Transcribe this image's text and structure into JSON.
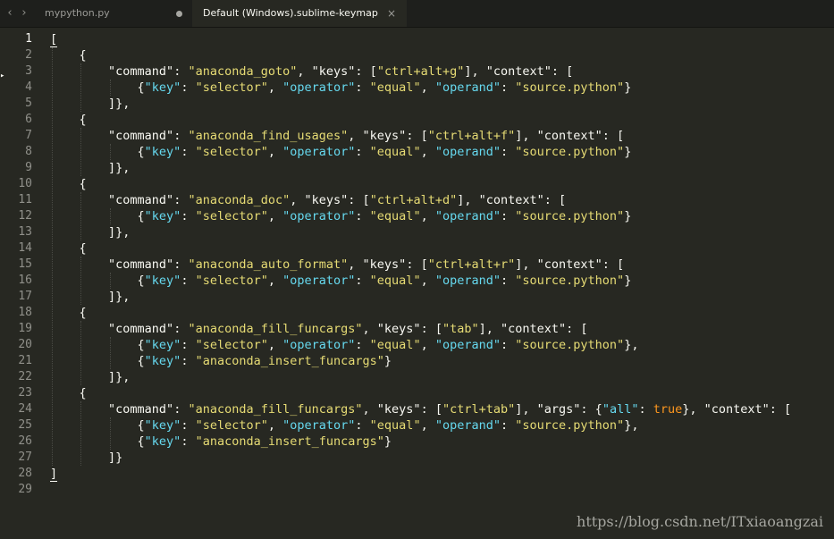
{
  "tabs": [
    {
      "label": "mypython.py",
      "active": false,
      "dirty": true
    },
    {
      "label": "Default (Windows).sublime-keymap",
      "active": true,
      "close_icon": "×"
    }
  ],
  "nav": {
    "back": "‹",
    "forward": "›"
  },
  "gutter": {
    "line_numbers": [
      "1",
      "2",
      "3",
      "4",
      "5",
      "6",
      "7",
      "8",
      "9",
      "10",
      "11",
      "12",
      "13",
      "14",
      "15",
      "16",
      "17",
      "18",
      "19",
      "20",
      "21",
      "22",
      "23",
      "24",
      "25",
      "26",
      "27",
      "28",
      "29"
    ],
    "active_line": "1"
  },
  "code_lines": [
    "[",
    "    {",
    "        \"command\": \"anaconda_goto\", \"keys\": [\"ctrl+alt+g\"], \"context\": [",
    "            {\"key\": \"selector\", \"operator\": \"equal\", \"operand\": \"source.python\"}",
    "        ]},",
    "    {",
    "        \"command\": \"anaconda_find_usages\", \"keys\": [\"ctrl+alt+f\"], \"context\": [",
    "            {\"key\": \"selector\", \"operator\": \"equal\", \"operand\": \"source.python\"}",
    "        ]},",
    "    {",
    "        \"command\": \"anaconda_doc\", \"keys\": [\"ctrl+alt+d\"], \"context\": [",
    "            {\"key\": \"selector\", \"operator\": \"equal\", \"operand\": \"source.python\"}",
    "        ]},",
    "    {",
    "        \"command\": \"anaconda_auto_format\", \"keys\": [\"ctrl+alt+r\"], \"context\": [",
    "            {\"key\": \"selector\", \"operator\": \"equal\", \"operand\": \"source.python\"}",
    "        ]},",
    "    {",
    "        \"command\": \"anaconda_fill_funcargs\", \"keys\": [\"tab\"], \"context\": [",
    "            {\"key\": \"selector\", \"operator\": \"equal\", \"operand\": \"source.python\"},",
    "            {\"key\": \"anaconda_insert_funcargs\"}",
    "        ]},",
    "    {",
    "        \"command\": \"anaconda_fill_funcargs\", \"keys\": [\"ctrl+tab\"], \"args\": {\"all\": true}, \"context\": [",
    "            {\"key\": \"selector\", \"operator\": \"equal\", \"operand\": \"source.python\"},",
    "            {\"key\": \"anaconda_insert_funcargs\"}",
    "        ]}",
    "]",
    ""
  ],
  "watermark": "https://blog.csdn.net/ITxiaoangzai",
  "colors": {
    "background": "#272822",
    "key_string": "#f8f8f2",
    "string_value": "#e6db74",
    "secondary_key": "#66d9ef",
    "boolean": "#fd971f"
  }
}
